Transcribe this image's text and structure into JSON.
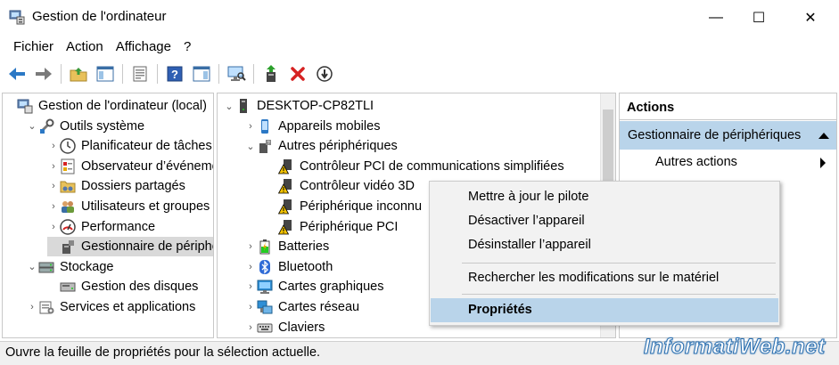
{
  "window": {
    "title": "Gestion de l'ordinateur",
    "min_glyph": "—",
    "max_glyph": "☐",
    "close_glyph": "✕"
  },
  "menu": [
    "Fichier",
    "Action",
    "Affichage",
    "?"
  ],
  "toolbar": [
    "back-icon",
    "forward-icon",
    "up-folder-icon",
    "show-hide-tree-icon",
    "properties-icon",
    "help-icon",
    "action-pane-icon",
    "scan-hardware-icon",
    "update-driver-icon",
    "uninstall-icon",
    "disable-icon"
  ],
  "left_tree": [
    {
      "label": "Gestion de l'ordinateur (local)",
      "icon": "computer-management-icon",
      "arrow": "",
      "level": 0
    },
    {
      "label": "Outils système",
      "icon": "system-tools-icon",
      "arrow": "⌄",
      "level": 1
    },
    {
      "label": "Planificateur de tâches",
      "icon": "clock-icon",
      "arrow": "›",
      "level": 2
    },
    {
      "label": "Observateur d’événements",
      "icon": "event-viewer-icon",
      "arrow": "›",
      "level": 2
    },
    {
      "label": "Dossiers partagés",
      "icon": "shared-folders-icon",
      "arrow": "›",
      "level": 2
    },
    {
      "label": "Utilisateurs et groupes locaux",
      "icon": "users-icon",
      "arrow": "›",
      "level": 2
    },
    {
      "label": "Performance",
      "icon": "performance-icon",
      "arrow": "›",
      "level": 2
    },
    {
      "label": "Gestionnaire de périphériques",
      "icon": "device-manager-icon",
      "arrow": "",
      "level": 2
    },
    {
      "label": "Stockage",
      "icon": "storage-icon",
      "arrow": "⌄",
      "level": 1
    },
    {
      "label": "Gestion des disques",
      "icon": "disk-icon",
      "arrow": "",
      "level": 2
    },
    {
      "label": "Services et applications",
      "icon": "services-icon",
      "arrow": "›",
      "level": 1
    }
  ],
  "device_tree": [
    {
      "label": "DESKTOP-CP82TLI",
      "icon": "computer-icon",
      "arrow": "⌄",
      "level": 0
    },
    {
      "label": "Appareils mobiles",
      "icon": "phone-icon",
      "arrow": "›",
      "level": 1
    },
    {
      "label": "Autres périphériques",
      "icon": "unknown-device-icon",
      "arrow": "⌄",
      "level": 1
    },
    {
      "label": "Contrôleur PCI de communications simplifiées",
      "icon": "warning-device-icon",
      "arrow": "",
      "level": 2
    },
    {
      "label": "Contrôleur vidéo 3D",
      "icon": "warning-device-icon",
      "arrow": "",
      "level": 2
    },
    {
      "label": "Périphérique inconnu",
      "icon": "warning-device-icon",
      "arrow": "",
      "level": 2
    },
    {
      "label": "Périphérique PCI",
      "icon": "warning-device-icon",
      "arrow": "",
      "level": 2
    },
    {
      "label": "Batteries",
      "icon": "battery-icon",
      "arrow": "›",
      "level": 1
    },
    {
      "label": "Bluetooth",
      "icon": "bluetooth-icon",
      "arrow": "›",
      "level": 1
    },
    {
      "label": "Cartes graphiques",
      "icon": "display-adapter-icon",
      "arrow": "›",
      "level": 1
    },
    {
      "label": "Cartes réseau",
      "icon": "network-adapter-icon",
      "arrow": "›",
      "level": 1
    },
    {
      "label": "Claviers",
      "icon": "keyboard-icon",
      "arrow": "›",
      "level": 1
    }
  ],
  "actions": {
    "header": "Actions",
    "section": "Gestionnaire de périphériques",
    "item": "Autres actions"
  },
  "context_menu": [
    {
      "label": "Mettre à jour le pilote",
      "bold": false,
      "highlight": false
    },
    {
      "label": "Désactiver l’appareil",
      "bold": false,
      "highlight": false
    },
    {
      "label": "Désinstaller l’appareil",
      "bold": false,
      "highlight": false
    },
    {
      "label": "Rechercher les modifications sur le matériel",
      "bold": false,
      "highlight": false
    },
    {
      "label": "Propriétés",
      "bold": true,
      "highlight": true
    }
  ],
  "status": "Ouvre la feuille de propriétés pour la sélection actuelle.",
  "watermark": "InformatiWeb.net",
  "colors": {
    "highlight": "#b9d4ea",
    "selected_grey": "#d9d9d9",
    "warning": "#f2c200"
  }
}
